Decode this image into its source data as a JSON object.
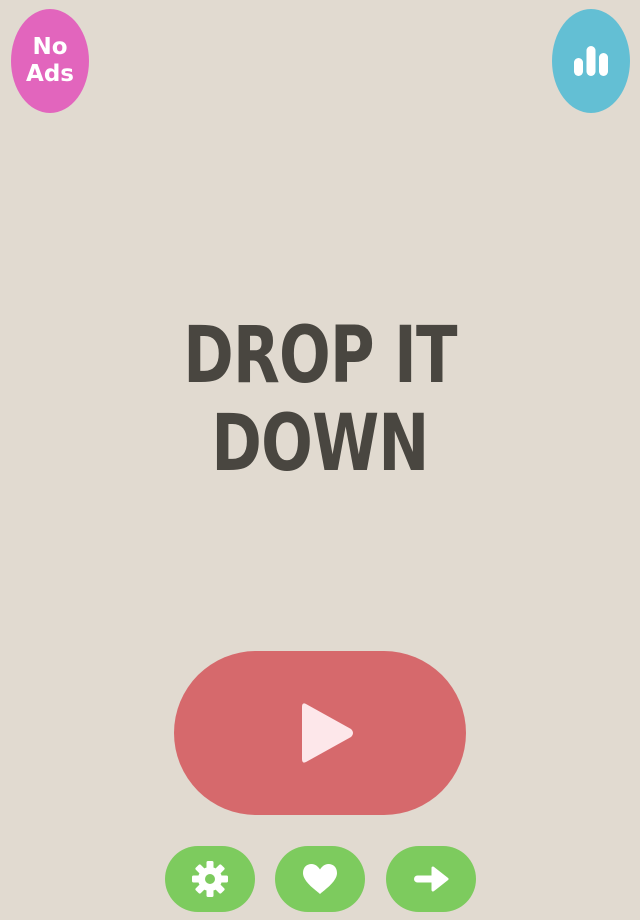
{
  "app": {
    "title_line1": "DROP IT",
    "title_line2": "DOWN"
  },
  "top_bar": {
    "no_ads_line1": "No",
    "no_ads_line2": "Ads",
    "leaderboard_icon": "bar-chart-icon"
  },
  "main": {
    "play_icon": "play-icon"
  },
  "bottom_bar": {
    "buttons": [
      {
        "icon": "gear-icon"
      },
      {
        "icon": "heart-icon"
      },
      {
        "icon": "arrow-right-icon"
      }
    ]
  },
  "colors": {
    "background": "#e1dad0",
    "no_ads": "#e265bd",
    "leaderboard": "#63bfd4",
    "title_text": "#494640",
    "play": "#d6696c",
    "bottom_buttons": "#7dcb5e"
  }
}
